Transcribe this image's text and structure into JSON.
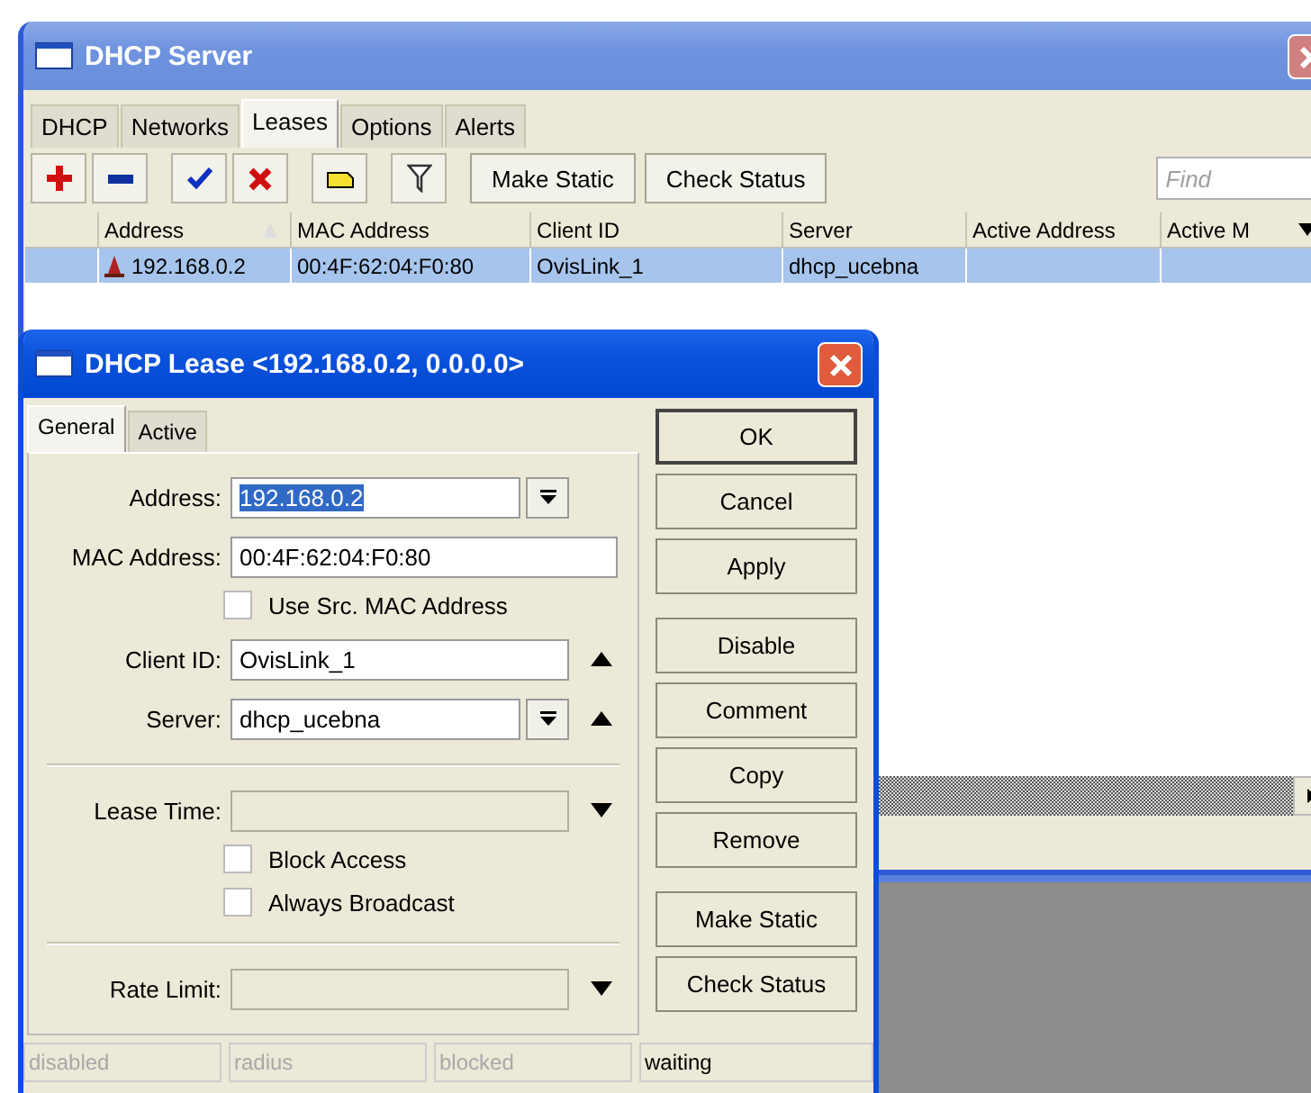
{
  "main_window": {
    "title": "DHCP Server",
    "tabs": [
      {
        "label": "DHCP",
        "selected": false
      },
      {
        "label": "Networks",
        "selected": false
      },
      {
        "label": "Leases",
        "selected": true
      },
      {
        "label": "Options",
        "selected": false
      },
      {
        "label": "Alerts",
        "selected": false
      }
    ],
    "toolbar_buttons": [
      "Make Static",
      "Check Status"
    ],
    "find": {
      "placeholder": "Find"
    },
    "table": {
      "columns": [
        {
          "label": "Address",
          "sorted": true
        },
        {
          "label": "MAC Address",
          "sorted": false
        },
        {
          "label": "Client ID",
          "sorted": false
        },
        {
          "label": "Server",
          "sorted": false
        },
        {
          "label": "Active Address",
          "sorted": false
        },
        {
          "label": "Active M",
          "sorted": false
        }
      ],
      "rows": [
        {
          "selected": true,
          "cells": [
            "192.168.0.2",
            "00:4F:62:04:F0:80",
            "OvisLink_1",
            "dhcp_ucebna",
            "",
            ""
          ]
        }
      ]
    }
  },
  "dialog": {
    "title": "DHCP Lease <192.168.0.2, 0.0.0.0>",
    "tabs": [
      {
        "label": "General",
        "selected": true
      },
      {
        "label": "Active",
        "selected": false
      }
    ],
    "fields": [
      {
        "kind": "text",
        "label": "Address:",
        "value": "192.168.0.2",
        "highlighted": true,
        "dropdown": true
      },
      {
        "kind": "text",
        "label": "MAC Address:",
        "value": "00:4F:62:04:F0:80"
      },
      {
        "kind": "checkbox",
        "label": "Use Src. MAC Address",
        "checked": false
      },
      {
        "kind": "text",
        "label": "Client ID:",
        "value": "OvisLink_1",
        "expanded": true
      },
      {
        "kind": "text",
        "label": "Server:",
        "value": "dhcp_ucebna",
        "dropdown": true,
        "expanded": true
      },
      {
        "kind": "divider"
      },
      {
        "kind": "text",
        "label": "Lease Time:",
        "disabled": true,
        "expanded": false
      },
      {
        "kind": "checkbox",
        "label": "Block Access",
        "checked": false
      },
      {
        "kind": "checkbox",
        "label": "Always Broadcast",
        "checked": false
      },
      {
        "kind": "divider"
      },
      {
        "kind": "text",
        "label": "Rate Limit:",
        "disabled": true,
        "expanded": false
      }
    ],
    "button_groups": [
      [
        {
          "label": "OK",
          "default": true
        },
        {
          "label": "Cancel",
          "default": false
        },
        {
          "label": "Apply",
          "default": false
        }
      ],
      [
        {
          "label": "Disable",
          "default": false
        },
        {
          "label": "Comment",
          "default": false
        },
        {
          "label": "Copy",
          "default": false
        },
        {
          "label": "Remove",
          "default": false
        }
      ],
      [
        {
          "label": "Make Static",
          "default": false
        },
        {
          "label": "Check Status",
          "default": false
        }
      ]
    ],
    "status": [
      {
        "label": "disabled",
        "active": false
      },
      {
        "label": "radius",
        "active": false
      },
      {
        "label": "blocked",
        "active": false
      },
      {
        "label": "waiting",
        "active": true
      }
    ]
  }
}
